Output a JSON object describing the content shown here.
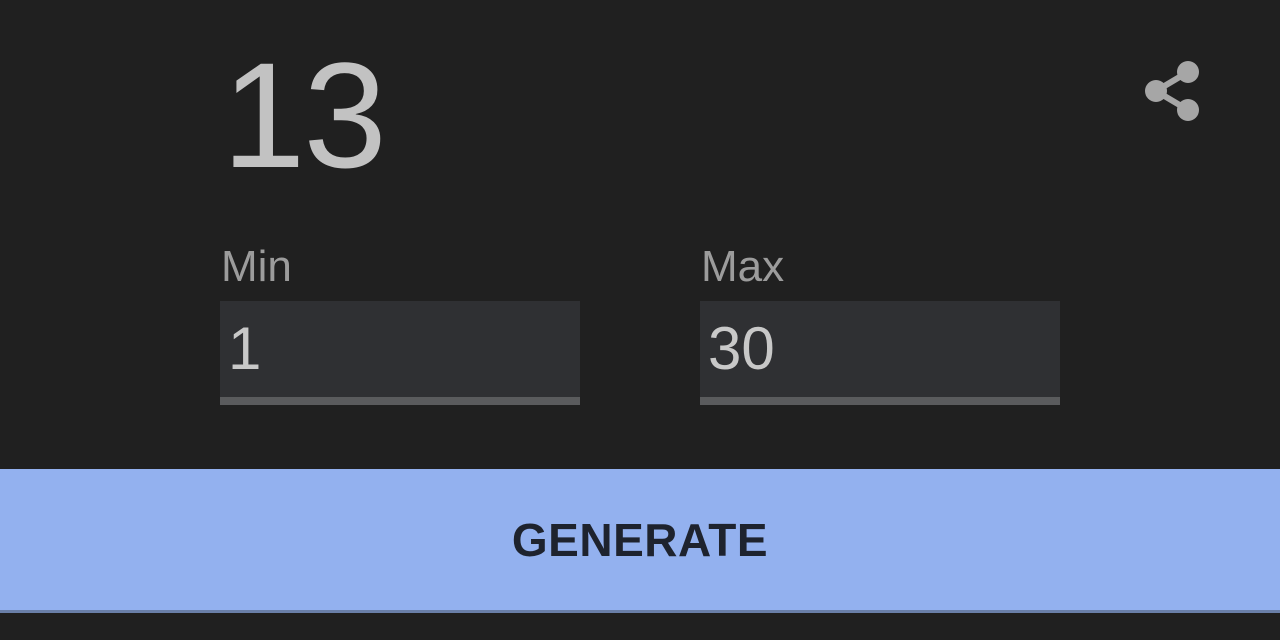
{
  "result": {
    "value": "13"
  },
  "share": {
    "icon": "share-icon"
  },
  "min": {
    "label": "Min",
    "value": "1"
  },
  "max": {
    "label": "Max",
    "value": "30"
  },
  "generate": {
    "label": "GENERATE"
  },
  "colors": {
    "background": "#202020",
    "accent": "#93b1ef",
    "field_bg": "#2f3033",
    "field_underline": "#5a5b5d",
    "text_primary": "#c2c2c2",
    "text_label": "#9c9c9c",
    "button_text": "#1e232e"
  }
}
